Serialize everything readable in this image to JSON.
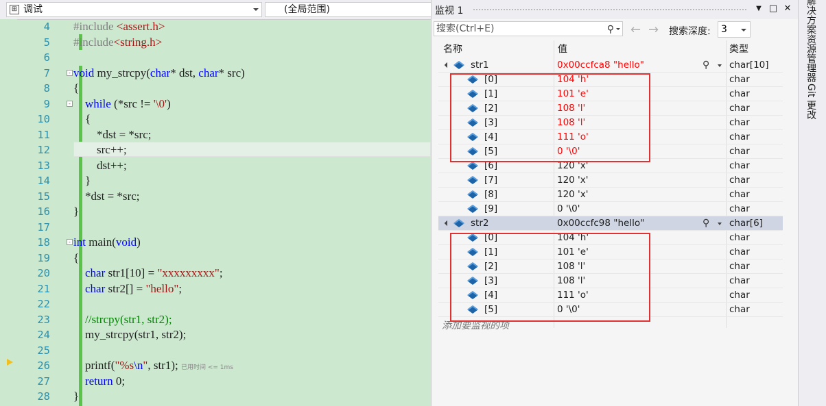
{
  "editor": {
    "scope_combo": "调试",
    "global_combo": "(全局范围)",
    "line_numbers": [
      "4",
      "5",
      "6",
      "7",
      "8",
      "9",
      "10",
      "11",
      "12",
      "13",
      "14",
      "15",
      "16",
      "17",
      "18",
      "19",
      "20",
      "21",
      "22",
      "23",
      "24",
      "25",
      "26",
      "27",
      "28"
    ],
    "lines": {
      "l4a": "#include ",
      "l4b": "<assert.h>",
      "l5a": "#include",
      "l5b": "<string.h>",
      "l7a": "void",
      "l7b": " my_strcpy(",
      "l7c": "char",
      "l7d": "* dst, ",
      "l7e": "char",
      "l7f": "* src)",
      "l8": "{",
      "l9a": "    while",
      "l9b": " (*src != ",
      "l9c": "'\\0'",
      "l9d": ")",
      "l10": "    {",
      "l11": "        *dst = *src;",
      "l12": "        src++;",
      "l13": "        dst++;",
      "l14": "    }",
      "l15": "    *dst = *src;",
      "l16": "}",
      "l18a": "int",
      "l18b": " main(",
      "l18c": "void",
      "l18d": ")",
      "l19": "{",
      "l20a": "    char",
      "l20b": " str1[10] = ",
      "l20c": "\"xxxxxxxxx\"",
      "l20d": ";",
      "l21a": "    char",
      "l21b": " str2[] = ",
      "l21c": "\"hello\"",
      "l21d": ";",
      "l23": "    //strcpy(str1, str2);",
      "l24": "    my_strcpy(str1, str2);",
      "l26a": "    printf(",
      "l26b": "\"%s",
      "l26c": "\\n",
      "l26d": "\"",
      "l26e": ", str1); ",
      "l26f": "已用时间 <= 1ms",
      "l27a": "    return",
      "l27b": " 0;",
      "l28": "}"
    }
  },
  "watch": {
    "title": "监视 1",
    "search_placeholder": "搜索(Ctrl+E)",
    "depth_label": "搜索深度:",
    "depth_value": "3",
    "columns": {
      "name": "名称",
      "value": "值",
      "type": "类型"
    },
    "str1": {
      "name": "str1",
      "value": "0x00ccfca8 \"hello\"",
      "type": "char[10]"
    },
    "str1_items": [
      {
        "name": "[0]",
        "value": "104 'h'",
        "type": "char"
      },
      {
        "name": "[1]",
        "value": "101 'e'",
        "type": "char"
      },
      {
        "name": "[2]",
        "value": "108 'l'",
        "type": "char"
      },
      {
        "name": "[3]",
        "value": "108 'l'",
        "type": "char"
      },
      {
        "name": "[4]",
        "value": "111 'o'",
        "type": "char"
      },
      {
        "name": "[5]",
        "value": "0 '\\0'",
        "type": "char"
      },
      {
        "name": "[6]",
        "value": "120 'x'",
        "type": "char"
      },
      {
        "name": "[7]",
        "value": "120 'x'",
        "type": "char"
      },
      {
        "name": "[8]",
        "value": "120 'x'",
        "type": "char"
      },
      {
        "name": "[9]",
        "value": "0 '\\0'",
        "type": "char"
      }
    ],
    "str2": {
      "name": "str2",
      "value": "0x00ccfc98 \"hello\"",
      "type": "char[6]"
    },
    "str2_items": [
      {
        "name": "[0]",
        "value": "104 'h'",
        "type": "char"
      },
      {
        "name": "[1]",
        "value": "101 'e'",
        "type": "char"
      },
      {
        "name": "[2]",
        "value": "108 'l'",
        "type": "char"
      },
      {
        "name": "[3]",
        "value": "108 'l'",
        "type": "char"
      },
      {
        "name": "[4]",
        "value": "111 'o'",
        "type": "char"
      },
      {
        "name": "[5]",
        "value": "0 '\\0'",
        "type": "char"
      }
    ],
    "add_hint": "添加要监视的项"
  },
  "rail": {
    "tab1": "解决方案资源管理器",
    "tab2": "Git 更改"
  },
  "colors": {
    "editor_bg": "#cce8cf",
    "changed_value": "#ff0000",
    "highlight_box": "#e03030",
    "line_number": "#2b91af",
    "keyword": "#0000ff"
  }
}
